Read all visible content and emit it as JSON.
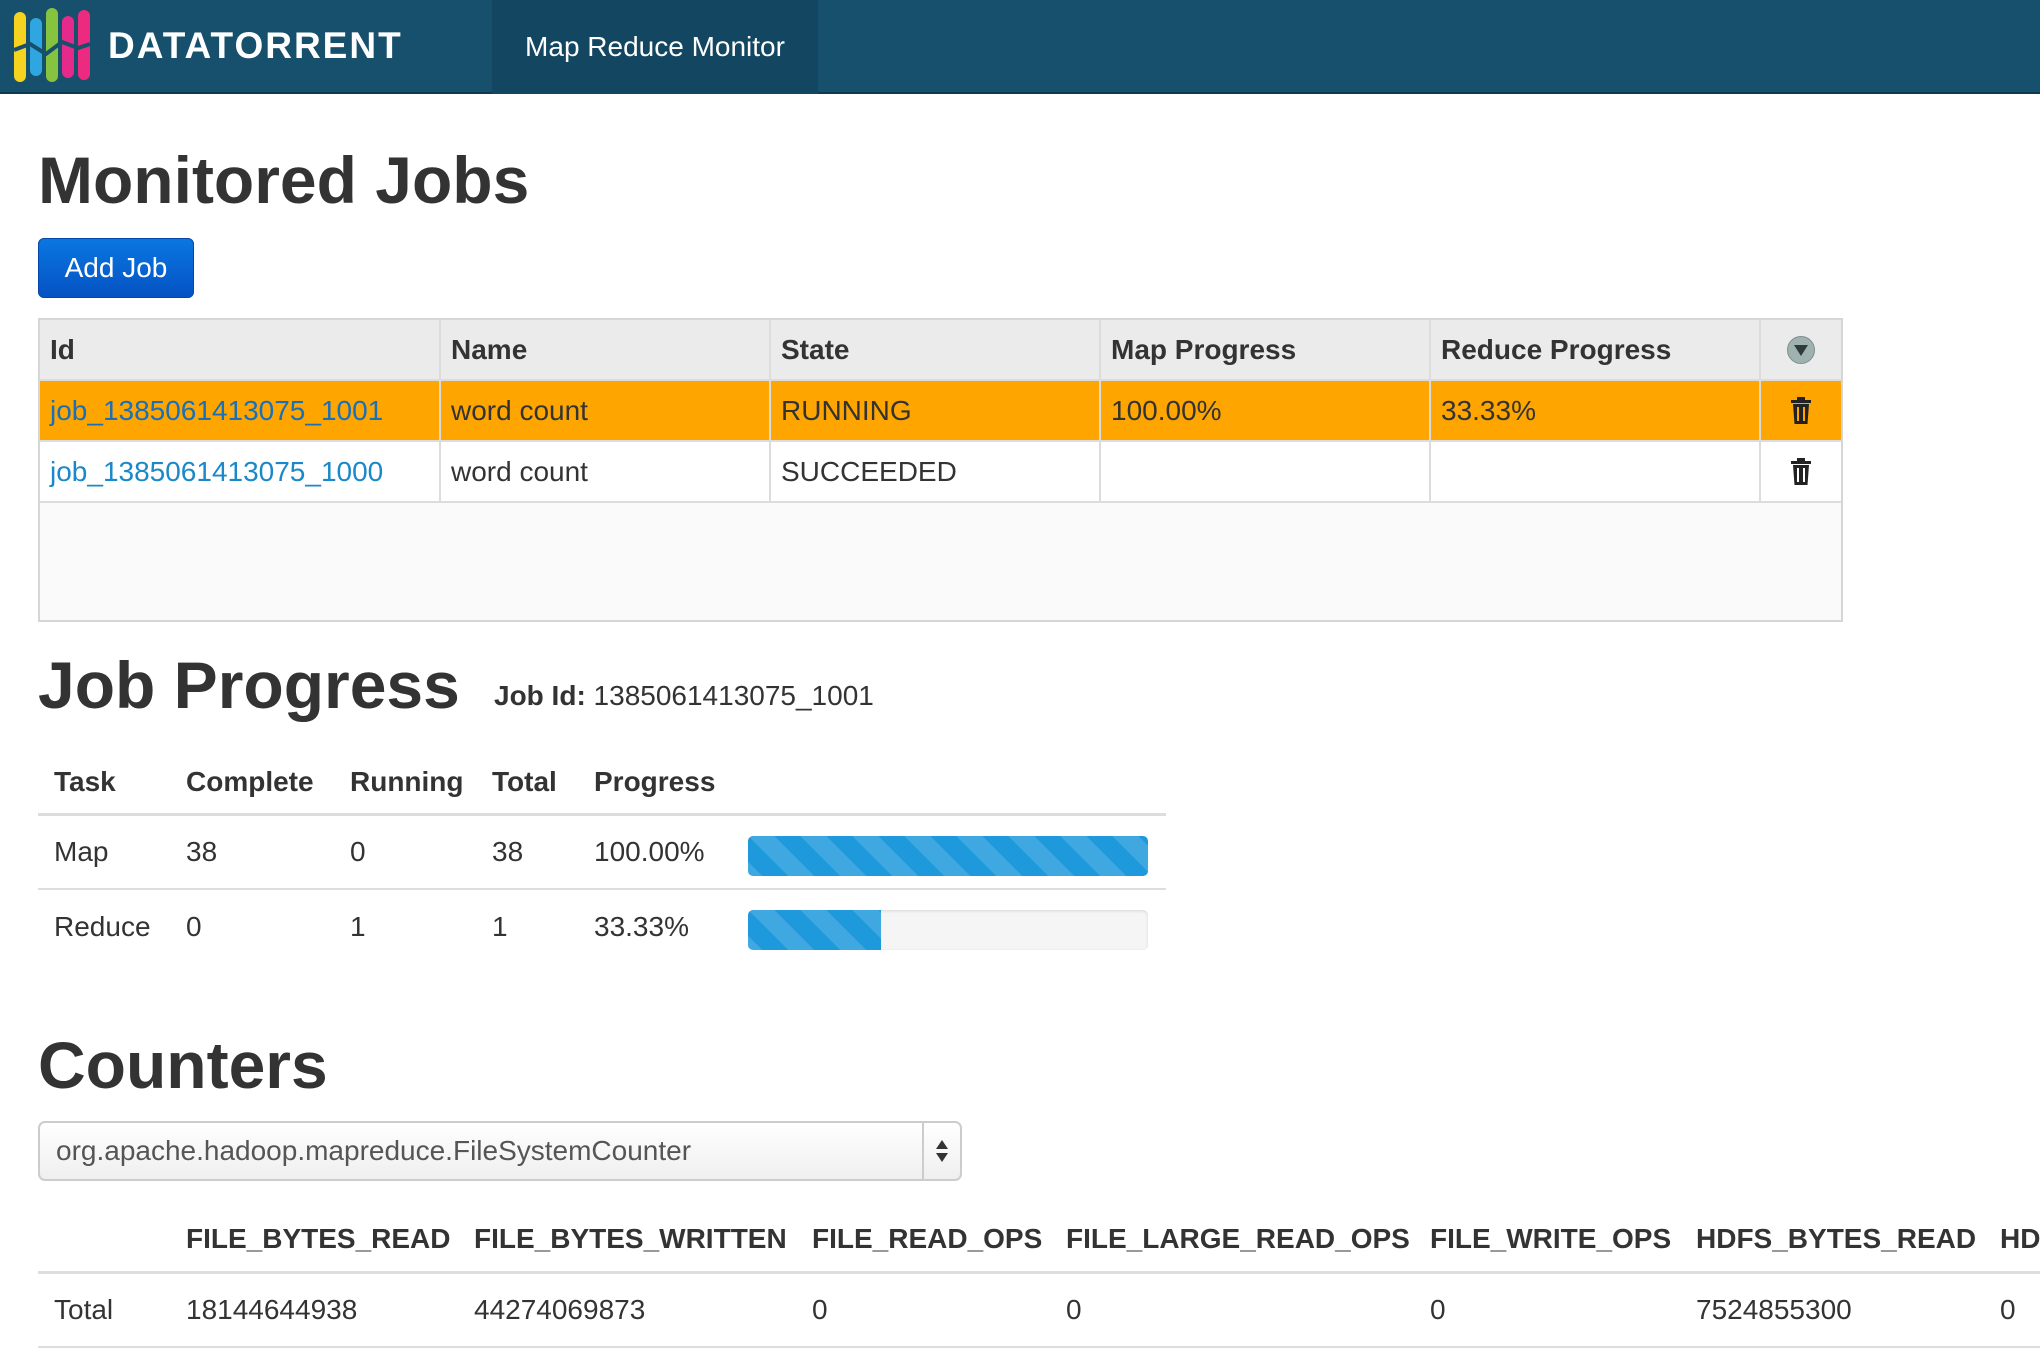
{
  "navbar": {
    "brand": "DATATORRENT",
    "tab": "Map Reduce Monitor",
    "colors": {
      "bg": "#17506c"
    }
  },
  "jobs_section": {
    "title": "Monitored Jobs",
    "add_button": "Add Job",
    "columns": [
      "Id",
      "Name",
      "State",
      "Map Progress",
      "Reduce Progress"
    ],
    "column_toggle_icon": "chevron-down-icon",
    "rows": [
      {
        "id": "job_1385061413075_1001",
        "name": "word count",
        "state": "RUNNING",
        "map": "100.00%",
        "reduce": "33.33%",
        "selected": true
      },
      {
        "id": "job_1385061413075_1000",
        "name": "word count",
        "state": "SUCCEEDED",
        "map": "",
        "reduce": "",
        "selected": false
      }
    ],
    "selected_row_color": "#ffa500",
    "row_action_icon": "trash-icon"
  },
  "progress_section": {
    "title": "Job Progress",
    "job_id_label": "Job Id:",
    "job_id_value": "1385061413075_1001",
    "columns": [
      "Task",
      "Complete",
      "Running",
      "Total",
      "Progress"
    ],
    "rows": [
      {
        "task": "Map",
        "complete": "38",
        "running": "0",
        "total": "38",
        "progress": "100.00%",
        "fraction": 1.0
      },
      {
        "task": "Reduce",
        "complete": "0",
        "running": "1",
        "total": "1",
        "progress": "33.33%",
        "fraction": 0.3333
      }
    ]
  },
  "counters_section": {
    "title": "Counters",
    "group_select": "org.apache.hadoop.mapreduce.FileSystemCounter",
    "columns": [
      "",
      "FILE_BYTES_READ",
      "FILE_BYTES_WRITTEN",
      "FILE_READ_OPS",
      "FILE_LARGE_READ_OPS",
      "FILE_WRITE_OPS",
      "HDFS_BYTES_READ",
      "HD"
    ],
    "rows": [
      [
        "Total",
        "18144644938",
        "44274069873",
        "0",
        "0",
        "0",
        "7524855300",
        "0"
      ]
    ]
  }
}
